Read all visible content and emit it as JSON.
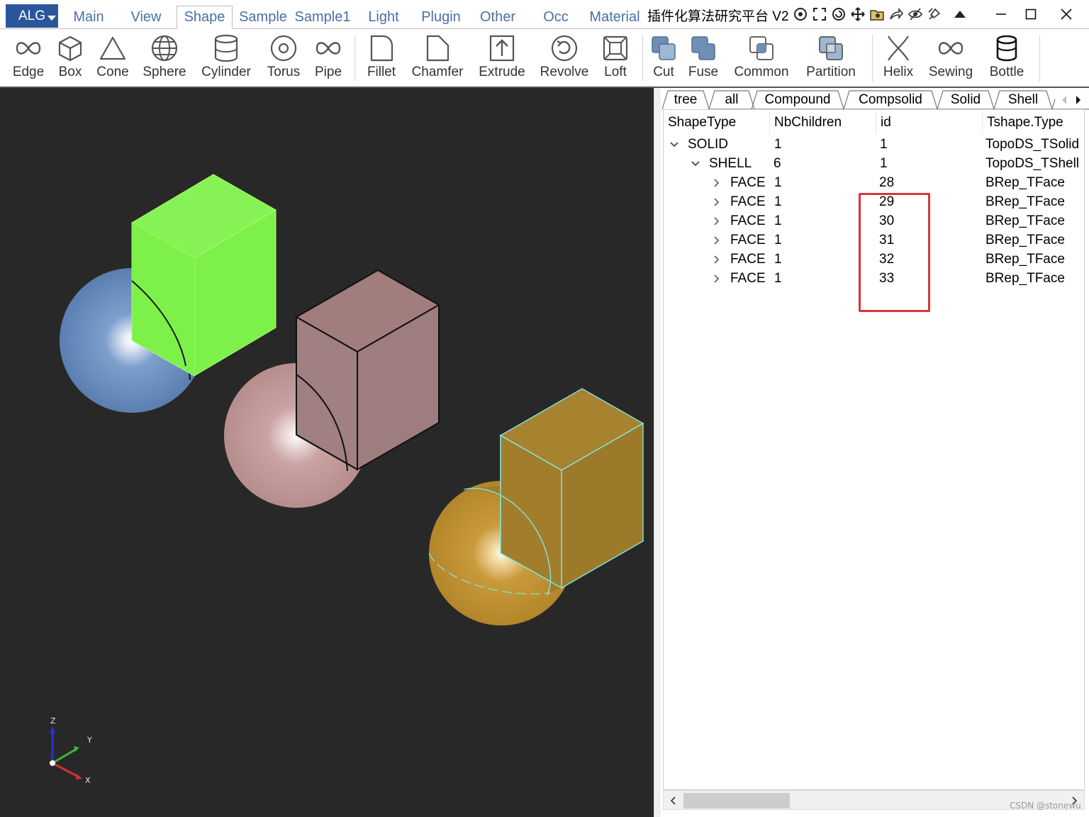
{
  "window": {
    "title": "插件化算法研究平台 V2",
    "app_button": "ALG",
    "tabs": [
      "Main",
      "View",
      "Shape",
      "Sample",
      "Sample1",
      "Light",
      "Plugin",
      "Other",
      "Occ",
      "Material"
    ],
    "active_tab": "Shape"
  },
  "ribbon": {
    "buttons": [
      "Edge",
      "Box",
      "Cone",
      "Sphere",
      "Cylinder",
      "Torus",
      "Pipe",
      "Fillet",
      "Chamfer",
      "Extrude",
      "Revolve",
      "Loft",
      "Cut",
      "Fuse",
      "Common",
      "Partition",
      "Helix",
      "Sewing",
      "Bottle"
    ]
  },
  "viewport": {
    "background": "#282828",
    "axes": {
      "z": "Z",
      "y": "Y",
      "x": "X"
    },
    "colors": {
      "green_box": "#7ef04a",
      "blue_sphere": "#5f86b8",
      "pink": "#b9908f",
      "gold": "#b88a2e",
      "highlight_edge": "#7fe8e0"
    }
  },
  "panel": {
    "tabs": [
      "tree",
      "all",
      "Compound",
      "Compsolid",
      "Solid",
      "Shell"
    ],
    "active_tab": "tree",
    "columns": [
      "ShapeType",
      "NbChildren",
      "id",
      "Tshape.Type"
    ],
    "rows": [
      {
        "shape_type": "SOLID",
        "nb_children": "1",
        "id": "1",
        "tshape_type": "TopoDS_TSolid",
        "level": 0,
        "expanded": true
      },
      {
        "shape_type": "SHELL",
        "nb_children": "6",
        "id": "1",
        "tshape_type": "TopoDS_TShell",
        "level": 1,
        "expanded": true
      },
      {
        "shape_type": "FACE",
        "nb_children": "1",
        "id": "28",
        "tshape_type": "BRep_TFace",
        "level": 2,
        "expanded": false
      },
      {
        "shape_type": "FACE",
        "nb_children": "1",
        "id": "29",
        "tshape_type": "BRep_TFace",
        "level": 2,
        "expanded": false
      },
      {
        "shape_type": "FACE",
        "nb_children": "1",
        "id": "30",
        "tshape_type": "BRep_TFace",
        "level": 2,
        "expanded": false
      },
      {
        "shape_type": "FACE",
        "nb_children": "1",
        "id": "31",
        "tshape_type": "BRep_TFace",
        "level": 2,
        "expanded": false
      },
      {
        "shape_type": "FACE",
        "nb_children": "1",
        "id": "32",
        "tshape_type": "BRep_TFace",
        "level": 2,
        "expanded": false
      },
      {
        "shape_type": "FACE",
        "nb_children": "1",
        "id": "33",
        "tshape_type": "BRep_TFace",
        "level": 2,
        "expanded": false
      }
    ],
    "highlight_color": "#d9373a"
  },
  "watermark": "CSDN @stonewu"
}
